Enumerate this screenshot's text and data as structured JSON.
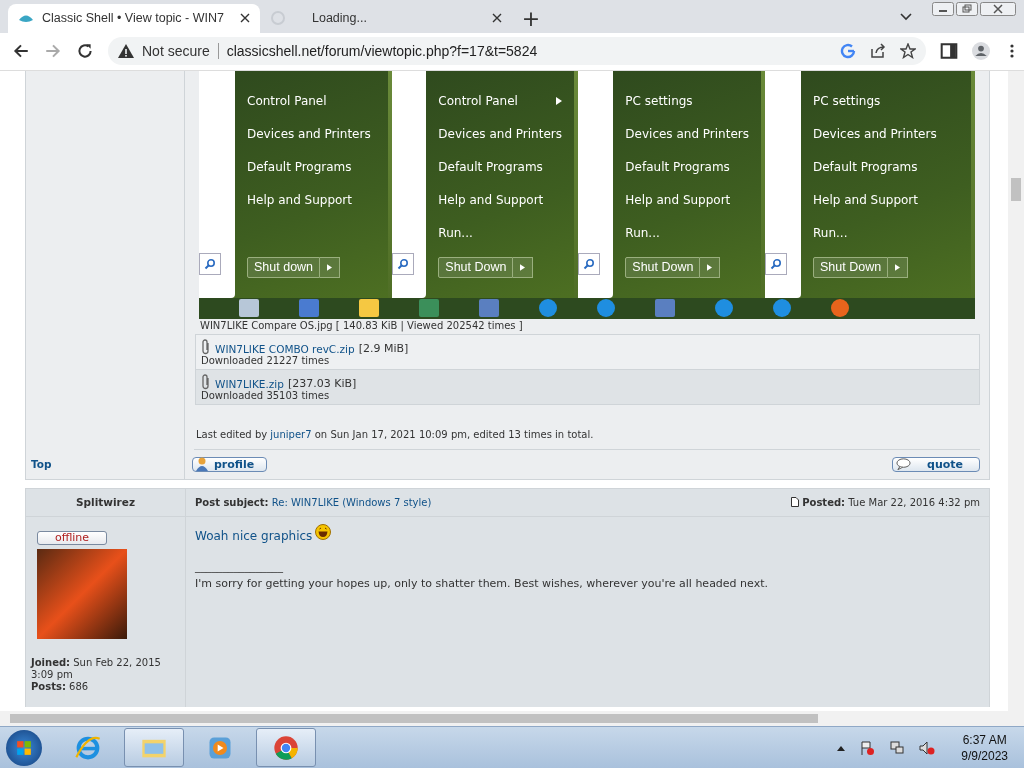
{
  "browser": {
    "tabs": [
      {
        "title": "Classic Shell • View topic - WIN7",
        "kind": "page",
        "selected": true
      },
      {
        "title": "Loading...",
        "kind": "loading",
        "selected": false
      }
    ],
    "new_tab": "+",
    "address": {
      "security": "Not secure",
      "url": "classicshell.net/forum/viewtopic.php?f=17&t=5824"
    }
  },
  "post1": {
    "image": {
      "panels": [
        {
          "items": [
            {
              "label": "Control Panel",
              "submenu": false
            },
            {
              "label": "Devices and Printers",
              "submenu": false
            },
            {
              "label": "Default Programs",
              "submenu": false
            },
            {
              "label": "Help and Support",
              "submenu": false
            }
          ],
          "shutdown": "Shut down"
        },
        {
          "items": [
            {
              "label": "Control Panel",
              "submenu": true
            },
            {
              "label": "Devices and Printers",
              "submenu": false
            },
            {
              "label": "Default Programs",
              "submenu": false
            },
            {
              "label": "Help and Support",
              "submenu": false
            },
            {
              "label": "Run...",
              "submenu": false
            }
          ],
          "shutdown": "Shut Down"
        },
        {
          "items": [
            {
              "label": "PC settings",
              "submenu": false
            },
            {
              "label": "Devices and Printers",
              "submenu": false
            },
            {
              "label": "Default Programs",
              "submenu": false
            },
            {
              "label": "Help and Support",
              "submenu": false
            },
            {
              "label": "Run...",
              "submenu": false
            }
          ],
          "shutdown": "Shut Down"
        },
        {
          "items": [
            {
              "label": "PC settings",
              "submenu": false
            },
            {
              "label": "Devices and Printers",
              "submenu": false
            },
            {
              "label": "Default Programs",
              "submenu": false
            },
            {
              "label": "Help and Support",
              "submenu": false
            },
            {
              "label": "Run...",
              "submenu": false
            }
          ],
          "shutdown": "Shut Down"
        }
      ],
      "caption": "WIN7LIKE Compare OS.jpg [ 140.83 KiB | Viewed 202542 times ]"
    },
    "attachments": [
      {
        "name": "WIN7LIKE COMBO revC.zip",
        "size": "[2.9 MiB]",
        "downloads": "Downloaded 21227 times"
      },
      {
        "name": "WIN7LIKE.zip",
        "size": "[237.03 KiB]",
        "downloads": "Downloaded 35103 times"
      }
    ],
    "last_edited": {
      "prefix": "Last edited by",
      "user": "juniper7",
      "suffix": "on Sun Jan 17, 2021 10:09 pm, edited 13 times in total."
    },
    "top_link": "Top",
    "profile_button": "profile",
    "quote_button": "quote"
  },
  "post2": {
    "author": "Splitwirez",
    "status": "offline",
    "subject_label": "Post subject:",
    "subject": "Re: WIN7LIKE (Windows 7 style)",
    "posted_label": "Posted:",
    "posted": "Tue Mar 22, 2016 4:32 pm",
    "body_link": "Woah nice graphics",
    "signature_rule": "________________",
    "signature": "I'm sorry for getting your hopes up, only to shatter them. Best wishes, wherever you're all headed next.",
    "profile": [
      {
        "label": "Joined:",
        "value": "Sun Feb 22, 2015 3:09 pm"
      },
      {
        "label": "Posts:",
        "value": "686"
      }
    ]
  },
  "taskbar": {
    "apps": [
      {
        "kind": "ie",
        "running": false
      },
      {
        "kind": "explorer",
        "running": true
      },
      {
        "kind": "media",
        "running": false
      },
      {
        "kind": "chrome",
        "running": true
      }
    ],
    "time": "6:37 AM",
    "date": "9/9/2023"
  }
}
